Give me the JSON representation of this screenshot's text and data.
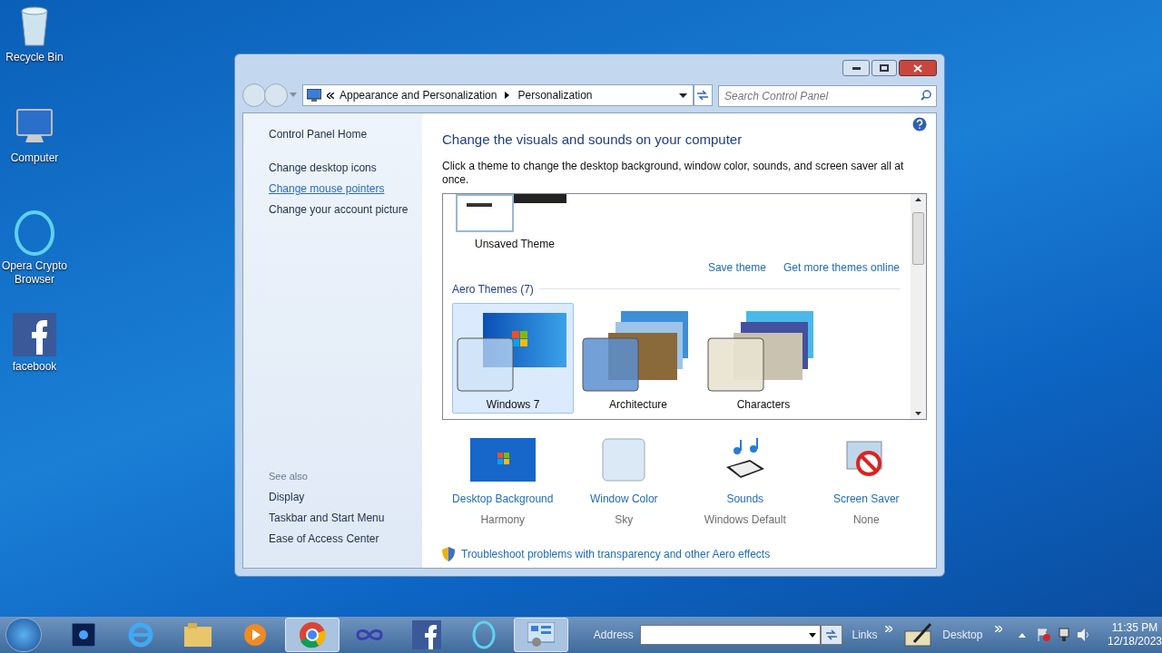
{
  "desktop_icons": [
    {
      "label": "Recycle Bin",
      "kind": "bin"
    },
    {
      "label": "Computer",
      "kind": "monitor"
    },
    {
      "label": "Opera Crypto Browser",
      "kind": "ring"
    },
    {
      "label": "facebook",
      "kind": "f"
    }
  ],
  "window": {
    "breadcrumb": [
      "Appearance and Personalization",
      "Personalization"
    ],
    "search": {
      "placeholder": "Search Control Panel"
    },
    "sidebar": {
      "home": "Control Panel Home",
      "links": [
        "Change desktop icons",
        "Change mouse pointers",
        "Change your account picture"
      ],
      "see_also_title": "See also",
      "see_also": [
        "Display",
        "Taskbar and Start Menu",
        "Ease of Access Center"
      ]
    },
    "title": "Change the visuals and sounds on your computer",
    "description": "Click a theme to change the desktop background, window color, sounds, and screen saver all at once.",
    "unsaved_theme": "Unsaved Theme",
    "theme_links": [
      "Save theme",
      "Get more themes online"
    ],
    "aero_title": "Aero Themes (7)",
    "themes": [
      {
        "name": "Windows 7",
        "kind": "win7",
        "selected": true
      },
      {
        "name": "Architecture",
        "kind": "arch",
        "selected": false
      },
      {
        "name": "Characters",
        "kind": "chars",
        "selected": false
      }
    ],
    "settings": [
      {
        "label": "Desktop Background",
        "value": "Harmony",
        "kind": "background"
      },
      {
        "label": "Window Color",
        "value": "Sky",
        "kind": "color"
      },
      {
        "label": "Sounds",
        "value": "Windows Default",
        "kind": "sounds"
      },
      {
        "label": "Screen Saver",
        "value": "None",
        "kind": "saver"
      }
    ],
    "troubleshoot": "Troubleshoot problems with transparency and other Aero effects"
  },
  "taskbar": {
    "apps": [
      {
        "kind": "ps",
        "selected": false
      },
      {
        "kind": "ie",
        "selected": false
      },
      {
        "kind": "folder",
        "selected": false
      },
      {
        "kind": "media",
        "selected": false
      },
      {
        "kind": "chrome",
        "selected": true
      },
      {
        "kind": "infinity",
        "selected": false
      },
      {
        "kind": "f",
        "selected": false
      },
      {
        "kind": "ring",
        "selected": false
      },
      {
        "kind": "panel",
        "selected": true
      }
    ],
    "address_label": "Address",
    "links": "Links",
    "desktop": "Desktop",
    "time": "11:35 PM",
    "date": "12/18/2023"
  }
}
